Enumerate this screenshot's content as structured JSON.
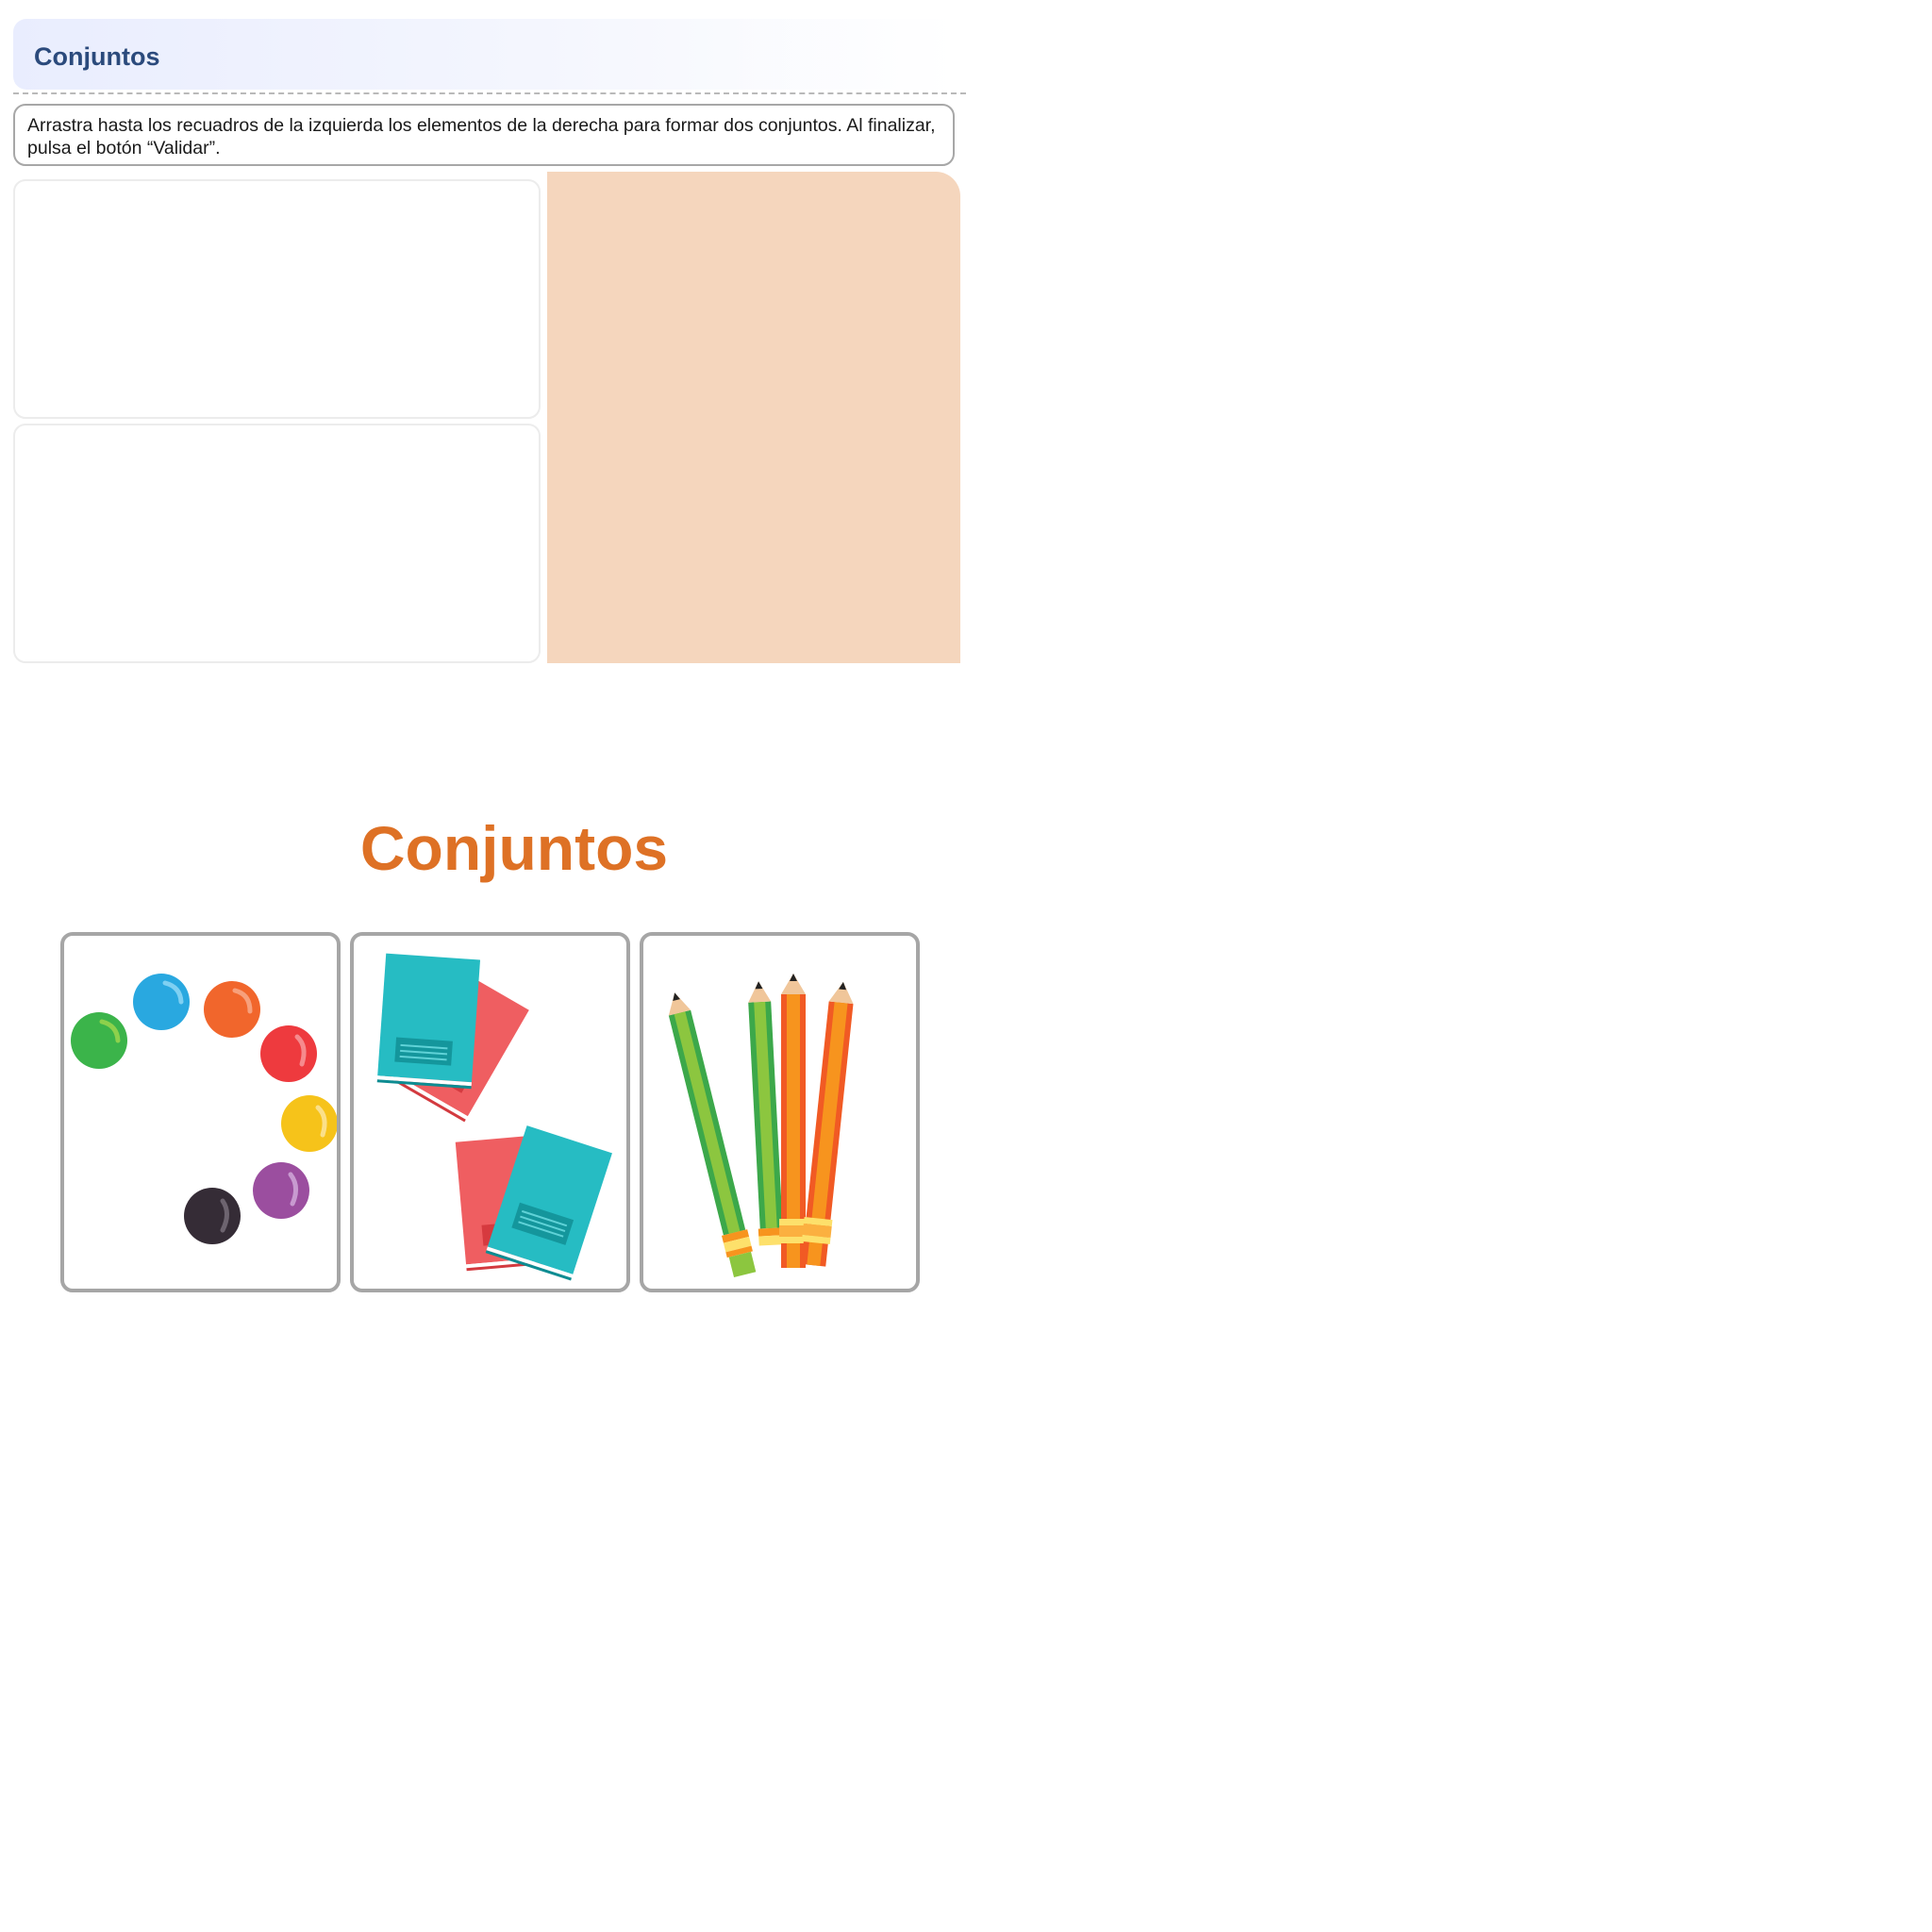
{
  "header": {
    "title": "Conjuntos"
  },
  "instructions": {
    "text": "Arrastra hasta los recuadros de la izquierda los elementos de la derecha para formar dos conjuntos. Al finalizar, pulsa el botón “Validar”."
  },
  "drop_zones": [
    {},
    {}
  ],
  "source_panel": {
    "color": "#f5d6bd"
  },
  "cards": {
    "title": "Conjuntos",
    "title_color": "#de7125",
    "items": [
      {
        "name": "marbles",
        "icon": "marbles-icon"
      },
      {
        "name": "books",
        "icon": "books-icon"
      },
      {
        "name": "pencils",
        "icon": "pencils-icon"
      }
    ]
  }
}
